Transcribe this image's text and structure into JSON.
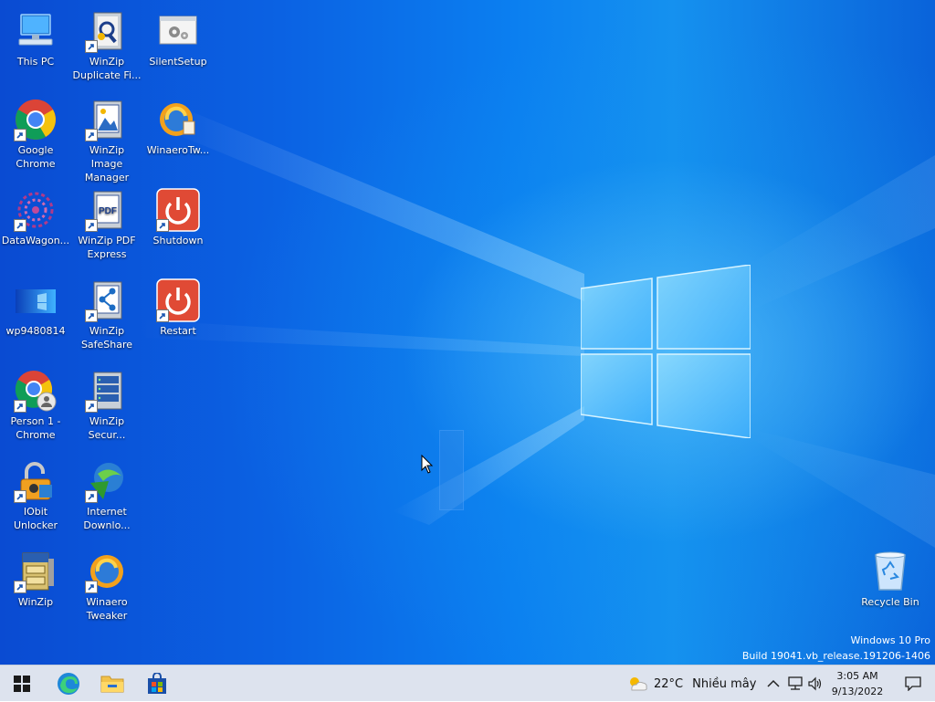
{
  "desktop": {
    "icons": [
      {
        "label": "This PC",
        "icon": "this-pc-icon"
      },
      {
        "label": "WinZip Duplicate Fi...",
        "icon": "winzip-duplicate-icon"
      },
      {
        "label": "SilentSetup",
        "icon": "silentsetup-icon"
      },
      {
        "label": "Google Chrome",
        "icon": "chrome-icon"
      },
      {
        "label": "WinZip Image Manager",
        "icon": "winzip-image-icon"
      },
      {
        "label": "WinaeroTw...",
        "icon": "winaero-tweaker-icon"
      },
      {
        "label": "DataWagon...",
        "icon": "datawagon-icon"
      },
      {
        "label": "WinZip PDF Express",
        "icon": "winzip-pdf-icon"
      },
      {
        "label": "Shutdown",
        "icon": "power-icon"
      },
      {
        "label": "wp9480814",
        "icon": "wallpaper-file-icon"
      },
      {
        "label": "WinZip SafeShare",
        "icon": "winzip-safeshare-icon"
      },
      {
        "label": "Restart",
        "icon": "power-icon"
      },
      {
        "label": "Person 1 - Chrome",
        "icon": "chrome-person-icon"
      },
      {
        "label": "WinZip Secur...",
        "icon": "winzip-secure-icon"
      },
      {
        "label": "IObit Unlocker",
        "icon": "iobit-unlocker-icon"
      },
      {
        "label": "Internet Downlo...",
        "icon": "internet-download-manager-icon"
      },
      {
        "label": "WinZip",
        "icon": "winzip-icon"
      },
      {
        "label": "Winaero Tweaker",
        "icon": "winaero-tweaker-icon"
      },
      {
        "label": "Recycle Bin",
        "icon": "recycle-bin-icon"
      }
    ],
    "watermark": {
      "line1": "Windows 10 Pro",
      "line2": "Build 19041.vb_release.191206-1406"
    }
  },
  "taskbar": {
    "start_icon": "windows-start-icon",
    "pinned": [
      {
        "name": "Microsoft Edge",
        "icon": "edge-icon"
      },
      {
        "name": "File Explorer",
        "icon": "file-explorer-icon"
      },
      {
        "name": "Microsoft Store",
        "icon": "store-icon"
      }
    ],
    "weather": {
      "temp": "22°C",
      "condition": "Nhiều mây",
      "icon": "partly-cloudy-icon"
    },
    "tray": {
      "icons": [
        "chevron-up-icon",
        "network-icon",
        "volume-icon"
      ]
    },
    "clock": {
      "time": "3:05 AM",
      "date": "9/13/2022"
    },
    "notification_icon": "notification-icon"
  },
  "colors": {
    "taskbar_bg": "#dde3ee",
    "desktop_accent": "#0b7ff0",
    "power_red": "#e04a35"
  }
}
